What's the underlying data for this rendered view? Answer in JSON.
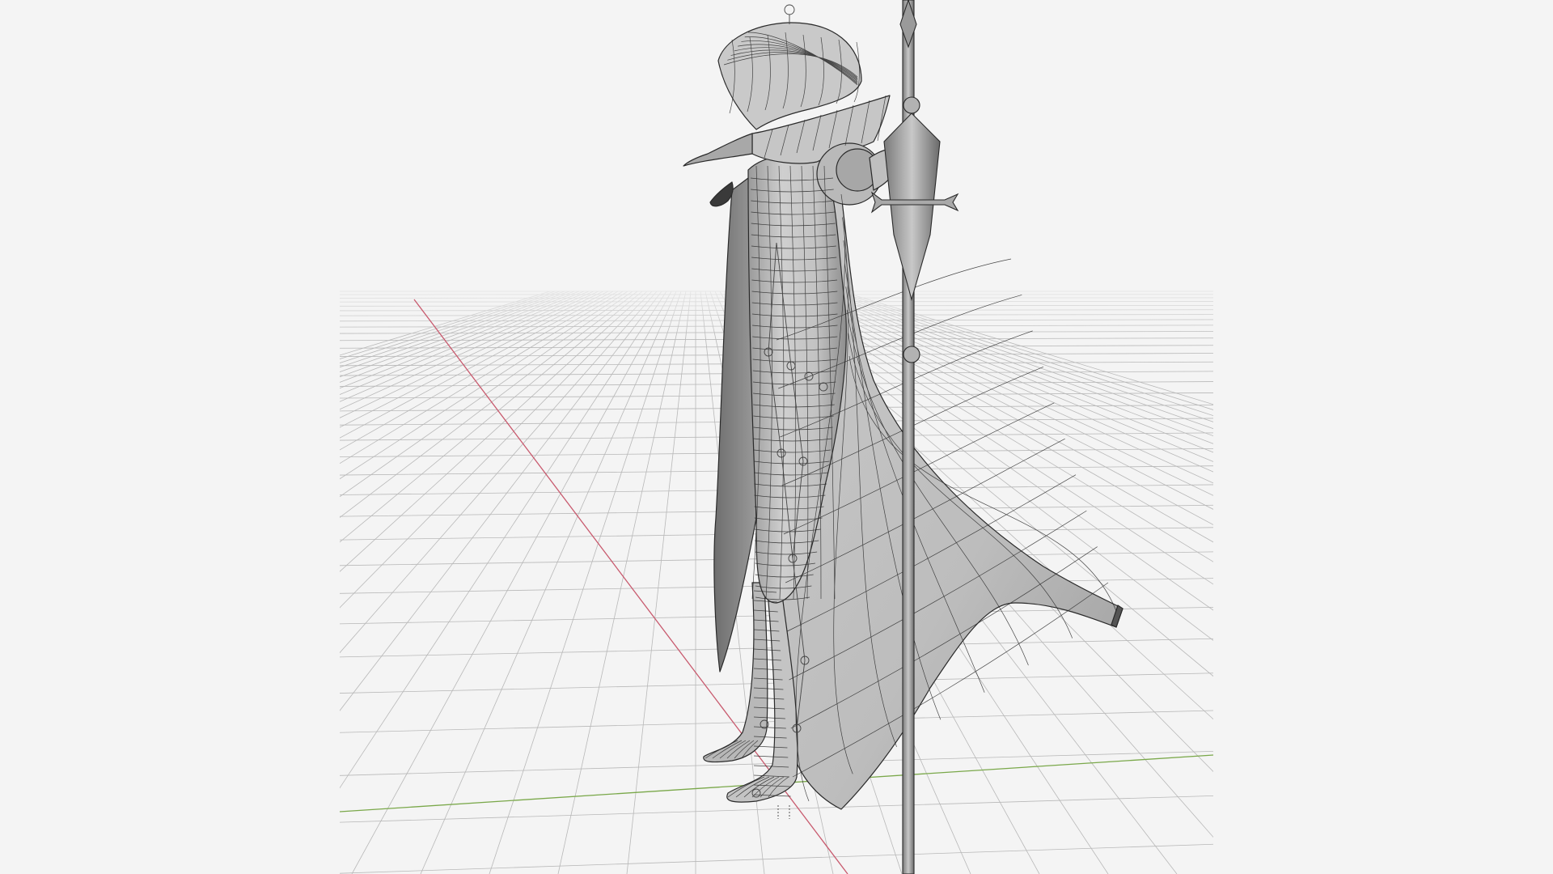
{
  "viewport": {
    "mode": "3d-viewport",
    "shading": "wireframe-over-solid",
    "background_color": "#f4f4f4",
    "grid_color": "#b8b8b8",
    "axis_x_color": "#c85a6e",
    "axis_y_color": "#7aa84a",
    "mesh_fill_color": "#bcbcbc",
    "mesh_wire_color": "#2a2a2a"
  },
  "scene": {
    "character": {
      "icon": "character-model-icon",
      "parts": [
        "hood",
        "collar",
        "coat",
        "legs",
        "boots",
        "shoulder-armor",
        "arm"
      ]
    },
    "weapon": {
      "icon": "spear-icon",
      "parts": [
        "spear-tip",
        "spear-head",
        "spear-crossguard",
        "spear-shaft"
      ]
    }
  }
}
